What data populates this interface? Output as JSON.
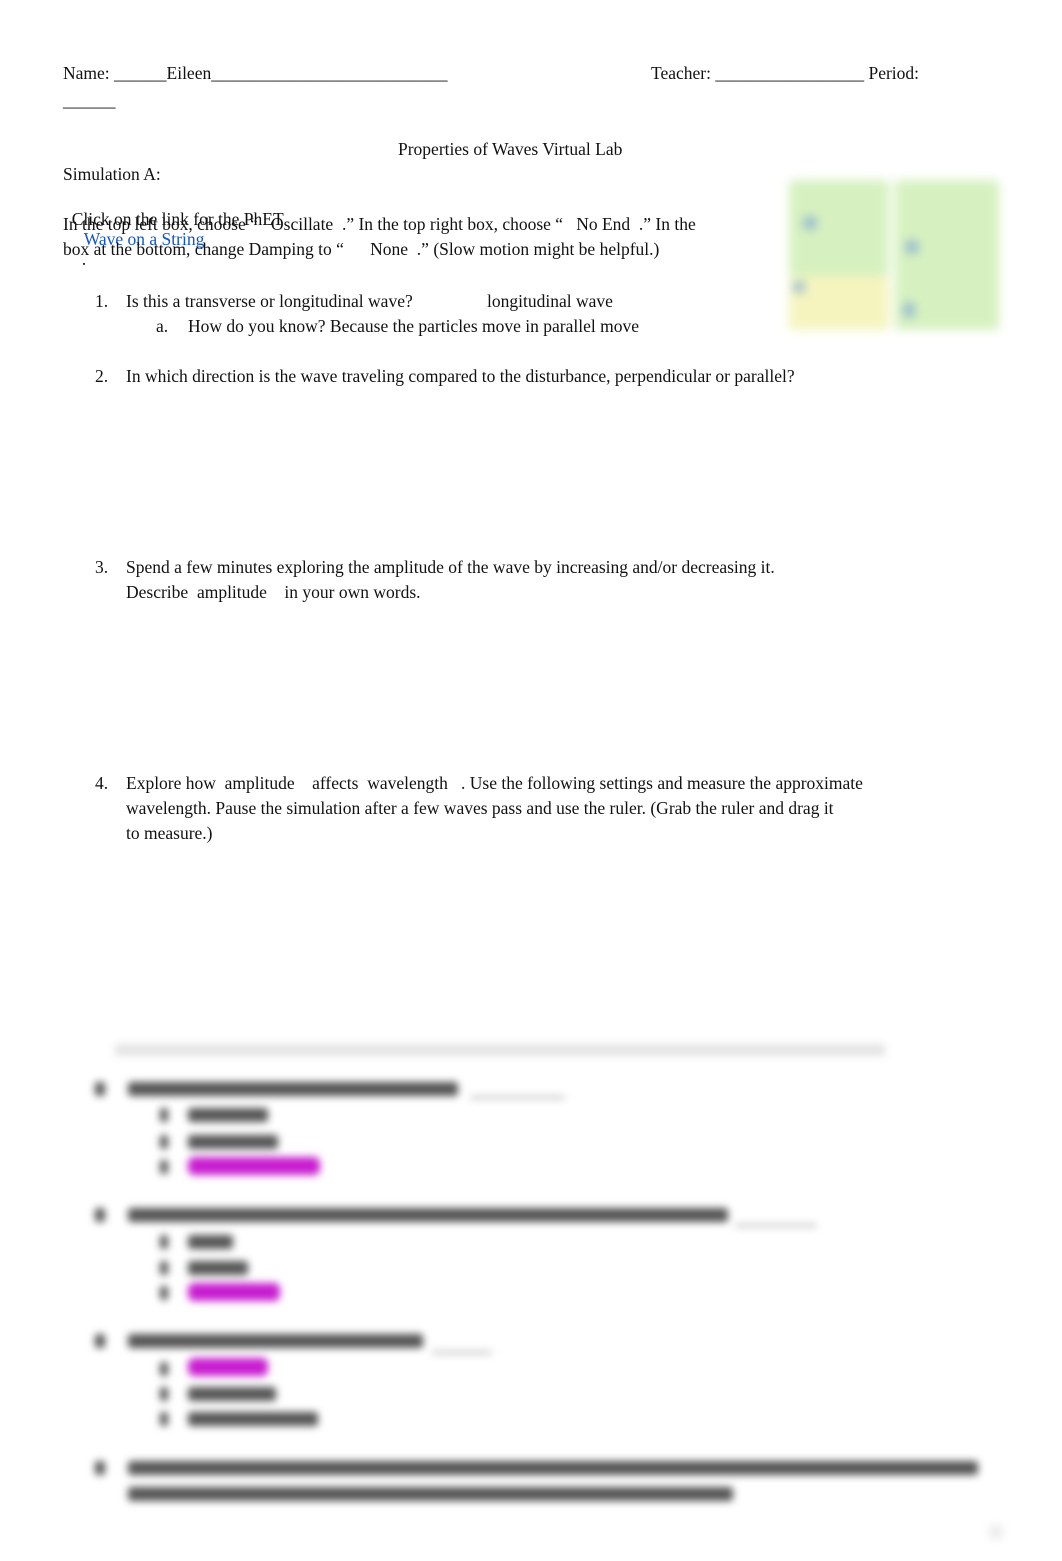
{
  "header": {
    "name_label": "Name: ______Eileen___________________________",
    "teacher_label": "Teacher: _________________ Period:",
    "period_blank": "______"
  },
  "title": "Properties of Waves Virtual Lab",
  "simulation": {
    "heading": "Simulation A:",
    "line1_prefix": "Click on the link for the PhET",
    "link_text": "Wave on a String",
    "line1_suffix": ".",
    "line2": "In the top left box, choose “   Oscillate  .” In the top right box, choose “   No End  .” In the",
    "line3": "box at the bottom, change Damping to “      None  .” (Slow motion might be helpful.)"
  },
  "questions": [
    {
      "number": "1.",
      "text": "Is this a transverse or longitudinal wave?",
      "answer": "longitudinal wave",
      "sub": {
        "letter": "a.",
        "text": "How do you know? Because the particles move in parallel move"
      }
    },
    {
      "number": "2.",
      "text": "In which direction is the wave traveling compared to the disturbance, perpendicular or parallel?"
    },
    {
      "number": "3.",
      "line1": "Spend a few minutes exploring the amplitude of the wave by increasing and/or decreasing it.",
      "line2": "Describe  amplitude    in your own words."
    },
    {
      "number": "4.",
      "line1": "Explore how  amplitude    affects  wavelength   . Use the following settings and measure the approximate",
      "line2": "wavelength. Pause the simulation after a few waves pass and use the ruler. (Grab the ruler and drag it",
      "line3": "to measure.)"
    }
  ],
  "colors": {
    "link": "#1155cc",
    "highlight": "#c81ed0",
    "thumbnail_green": "#cdeeb0",
    "thumbnail_yellow": "#f3f2b0"
  }
}
